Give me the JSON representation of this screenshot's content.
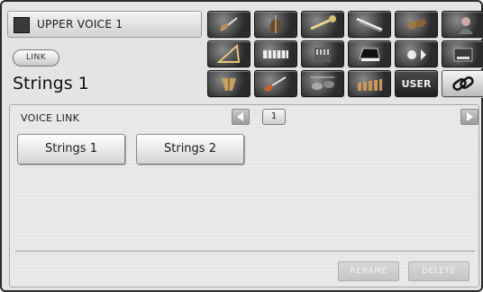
{
  "header": {
    "title": "UPPER VOICE 1",
    "link_badge": "LINK",
    "voice_name": "Strings 1"
  },
  "voice_categories": [
    {
      "icon": "violin-icon"
    },
    {
      "icon": "cello-icon"
    },
    {
      "icon": "brass-icon"
    },
    {
      "icon": "woodwind-icon"
    },
    {
      "icon": "string-ensemble-icon"
    },
    {
      "icon": "choir-icon"
    },
    {
      "icon": "harp-icon"
    },
    {
      "icon": "keyboard-icon"
    },
    {
      "icon": "organ-icon"
    },
    {
      "icon": "piano-icon"
    },
    {
      "icon": "world-instrument-icon"
    },
    {
      "icon": "theatre-organ-icon"
    },
    {
      "icon": "percussion-icon"
    },
    {
      "icon": "guitar-icon"
    },
    {
      "icon": "drum-kit-icon"
    },
    {
      "icon": "mallet-icon"
    },
    {
      "label": "USER",
      "icon": "user-icon"
    },
    {
      "icon": "link-icon"
    }
  ],
  "main": {
    "title": "VOICE LINK",
    "page": "1",
    "voices": [
      "Strings 1",
      "Strings 2"
    ],
    "actions": {
      "rename": "RENAME",
      "delete": "DELETE"
    }
  },
  "colors": {
    "panel": "#e9e9e9",
    "icon_dark": "#2b2b2b",
    "disabled_button": "#cdcdcd"
  }
}
